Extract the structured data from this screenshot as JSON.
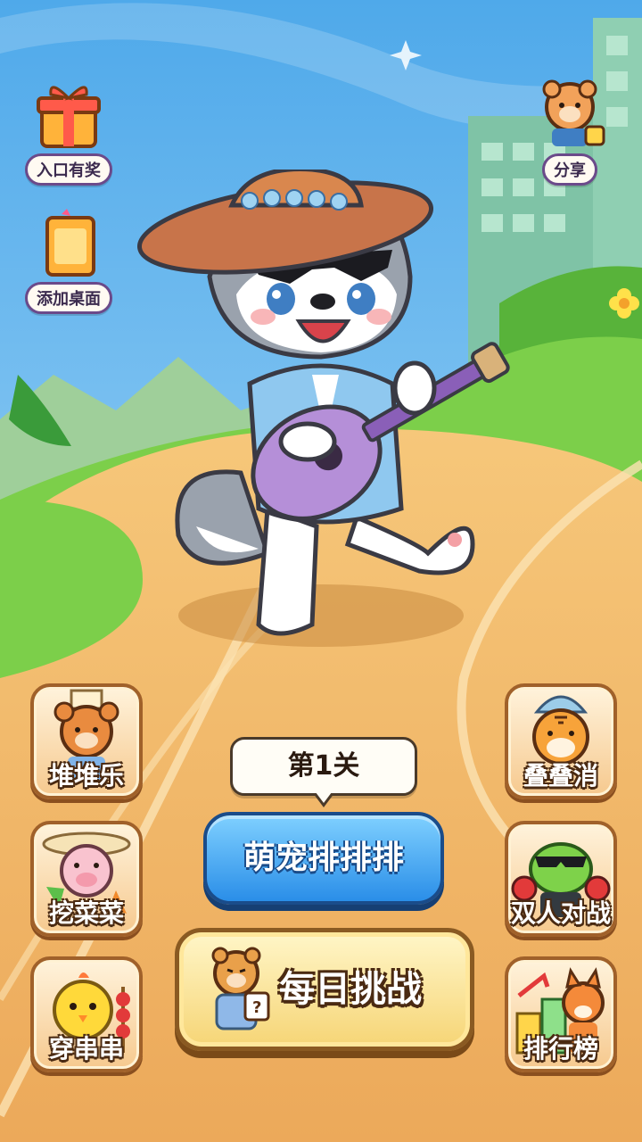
{
  "top_left": [
    {
      "label": "入口有奖",
      "icon": "gift-box-icon"
    },
    {
      "label": "添加桌面",
      "icon": "desktop-shortcut-icon"
    }
  ],
  "top_right": {
    "label": "分享",
    "icon": "share-bear-icon"
  },
  "mascot": {
    "icon": "husky-guitar-mascot"
  },
  "level": {
    "label": "第1关"
  },
  "main_button": {
    "label": "萌宠排排排"
  },
  "daily_button": {
    "label": "每日挑战",
    "icon": "thinking-bear-icon"
  },
  "left_games": [
    {
      "label": "堆堆乐",
      "icon": "bear-overalls-icon"
    },
    {
      "label": "挖菜菜",
      "icon": "pig-straw-hat-icon"
    },
    {
      "label": "穿串串",
      "icon": "chick-skewer-icon"
    }
  ],
  "right_games": [
    {
      "label": "叠叠消",
      "icon": "tiger-beanie-icon"
    },
    {
      "label": "双人对战",
      "icon": "frog-boxer-icon"
    },
    {
      "label": "排行榜",
      "icon": "fox-podium-icon"
    }
  ],
  "colors": {
    "sky": "#6fbfee",
    "track": "#f1b866",
    "grass": "#7ccf4a",
    "main_button": "#2a8ee8"
  }
}
